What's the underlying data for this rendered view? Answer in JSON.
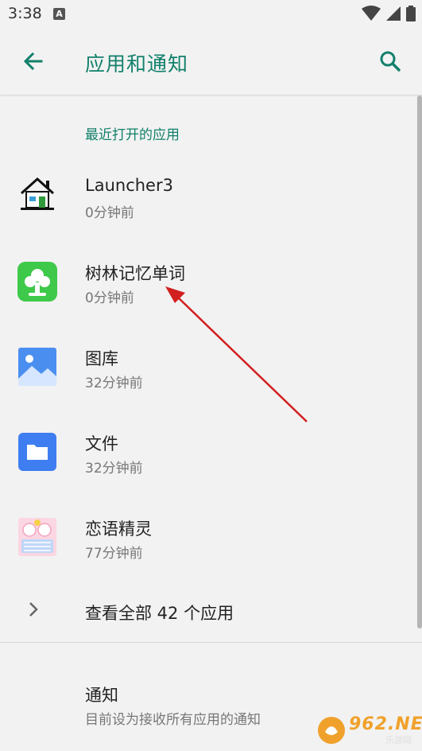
{
  "status_bar": {
    "time": "3:38",
    "notification_badge": "A"
  },
  "app_bar": {
    "title": "应用和通知",
    "back_icon": "arrow-back-icon",
    "search_icon": "search-icon",
    "accent": "#12806b"
  },
  "recent_section": {
    "header": "最近打开的应用",
    "apps": [
      {
        "name": "Launcher3",
        "time": "0分钟前",
        "icon": "house-icon"
      },
      {
        "name": "树林记忆单词",
        "time": "0分钟前",
        "icon": "tree-icon"
      },
      {
        "name": "图库",
        "time": "32分钟前",
        "icon": "gallery-icon"
      },
      {
        "name": "文件",
        "time": "32分钟前",
        "icon": "folder-icon"
      },
      {
        "name": "恋语精灵",
        "time": "77分钟前",
        "icon": "keyboard-theme-icon"
      }
    ]
  },
  "see_all": {
    "label": "查看全部 42 个应用"
  },
  "notifications": {
    "title": "通知",
    "subtitle": "目前设为接收所有应用的通知"
  },
  "watermark": {
    "text": "962",
    "suffix": ".NET",
    "sub": "乐游网"
  }
}
